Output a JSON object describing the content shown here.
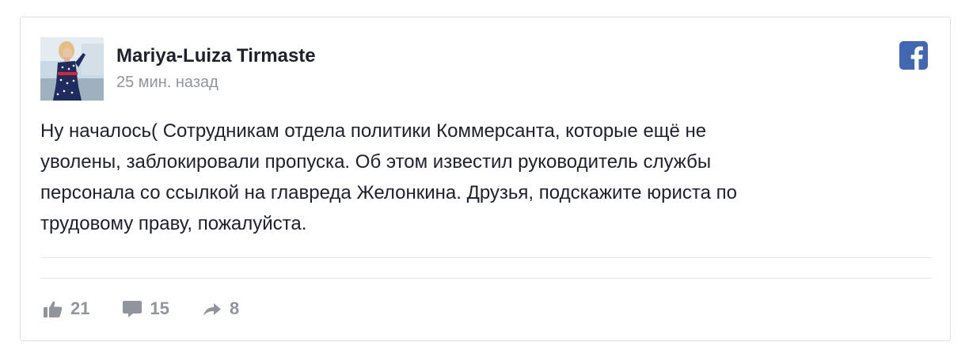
{
  "post": {
    "author": "Mariya-Luiza Tirmaste",
    "timestamp": "25 мин. назад",
    "text": "Ну началось( Сотрудникам отдела политики Коммерсанта, которые ещё не\nуволены, заблокировали пропуска. Об этом известил руководитель службы\nперсонала со ссылкой на главреда Желонкина. Друзья, подскажите юриста по\nтрудовому праву, пожалуйста."
  },
  "actions": {
    "likes": "21",
    "comments": "15",
    "shares": "8"
  },
  "icons": {
    "brand": "facebook-icon",
    "like": "thumbs-up-icon",
    "comment": "comment-bubble-icon",
    "share": "share-arrow-icon"
  },
  "colors": {
    "brand": "#4267b2",
    "text": "#1d2129",
    "muted": "#90949c"
  }
}
